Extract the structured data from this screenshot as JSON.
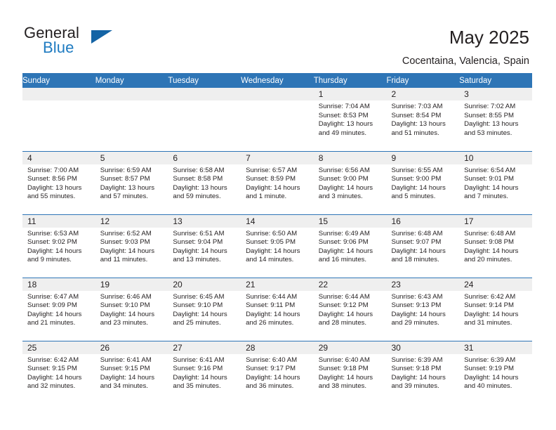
{
  "brand": {
    "line1": "General",
    "line2": "Blue",
    "accent_color": "#1f7bc1",
    "sail_color": "#1464a5"
  },
  "header": {
    "title": "May 2025",
    "location": "Cocentaina, Valencia, Spain"
  },
  "theme": {
    "header_blue": "#2e75b6",
    "daynum_band": "#efefef",
    "text": "#231f20"
  },
  "columns": [
    "Sunday",
    "Monday",
    "Tuesday",
    "Wednesday",
    "Thursday",
    "Friday",
    "Saturday"
  ],
  "labels": {
    "sunrise_prefix": "Sunrise:",
    "sunset_prefix": "Sunset:",
    "daylight_prefix": "Daylight:"
  },
  "weeks": [
    [
      {
        "day": "",
        "empty": true
      },
      {
        "day": "",
        "empty": true
      },
      {
        "day": "",
        "empty": true
      },
      {
        "day": "",
        "empty": true
      },
      {
        "day": "1",
        "sunrise": "Sunrise: 7:04 AM",
        "sunset": "Sunset: 8:53 PM",
        "daylight_l1": "Daylight: 13 hours",
        "daylight_l2": "and 49 minutes."
      },
      {
        "day": "2",
        "sunrise": "Sunrise: 7:03 AM",
        "sunset": "Sunset: 8:54 PM",
        "daylight_l1": "Daylight: 13 hours",
        "daylight_l2": "and 51 minutes."
      },
      {
        "day": "3",
        "sunrise": "Sunrise: 7:02 AM",
        "sunset": "Sunset: 8:55 PM",
        "daylight_l1": "Daylight: 13 hours",
        "daylight_l2": "and 53 minutes."
      }
    ],
    [
      {
        "day": "4",
        "sunrise": "Sunrise: 7:00 AM",
        "sunset": "Sunset: 8:56 PM",
        "daylight_l1": "Daylight: 13 hours",
        "daylight_l2": "and 55 minutes."
      },
      {
        "day": "5",
        "sunrise": "Sunrise: 6:59 AM",
        "sunset": "Sunset: 8:57 PM",
        "daylight_l1": "Daylight: 13 hours",
        "daylight_l2": "and 57 minutes."
      },
      {
        "day": "6",
        "sunrise": "Sunrise: 6:58 AM",
        "sunset": "Sunset: 8:58 PM",
        "daylight_l1": "Daylight: 13 hours",
        "daylight_l2": "and 59 minutes."
      },
      {
        "day": "7",
        "sunrise": "Sunrise: 6:57 AM",
        "sunset": "Sunset: 8:59 PM",
        "daylight_l1": "Daylight: 14 hours",
        "daylight_l2": "and 1 minute."
      },
      {
        "day": "8",
        "sunrise": "Sunrise: 6:56 AM",
        "sunset": "Sunset: 9:00 PM",
        "daylight_l1": "Daylight: 14 hours",
        "daylight_l2": "and 3 minutes."
      },
      {
        "day": "9",
        "sunrise": "Sunrise: 6:55 AM",
        "sunset": "Sunset: 9:00 PM",
        "daylight_l1": "Daylight: 14 hours",
        "daylight_l2": "and 5 minutes."
      },
      {
        "day": "10",
        "sunrise": "Sunrise: 6:54 AM",
        "sunset": "Sunset: 9:01 PM",
        "daylight_l1": "Daylight: 14 hours",
        "daylight_l2": "and 7 minutes."
      }
    ],
    [
      {
        "day": "11",
        "sunrise": "Sunrise: 6:53 AM",
        "sunset": "Sunset: 9:02 PM",
        "daylight_l1": "Daylight: 14 hours",
        "daylight_l2": "and 9 minutes."
      },
      {
        "day": "12",
        "sunrise": "Sunrise: 6:52 AM",
        "sunset": "Sunset: 9:03 PM",
        "daylight_l1": "Daylight: 14 hours",
        "daylight_l2": "and 11 minutes."
      },
      {
        "day": "13",
        "sunrise": "Sunrise: 6:51 AM",
        "sunset": "Sunset: 9:04 PM",
        "daylight_l1": "Daylight: 14 hours",
        "daylight_l2": "and 13 minutes."
      },
      {
        "day": "14",
        "sunrise": "Sunrise: 6:50 AM",
        "sunset": "Sunset: 9:05 PM",
        "daylight_l1": "Daylight: 14 hours",
        "daylight_l2": "and 14 minutes."
      },
      {
        "day": "15",
        "sunrise": "Sunrise: 6:49 AM",
        "sunset": "Sunset: 9:06 PM",
        "daylight_l1": "Daylight: 14 hours",
        "daylight_l2": "and 16 minutes."
      },
      {
        "day": "16",
        "sunrise": "Sunrise: 6:48 AM",
        "sunset": "Sunset: 9:07 PM",
        "daylight_l1": "Daylight: 14 hours",
        "daylight_l2": "and 18 minutes."
      },
      {
        "day": "17",
        "sunrise": "Sunrise: 6:48 AM",
        "sunset": "Sunset: 9:08 PM",
        "daylight_l1": "Daylight: 14 hours",
        "daylight_l2": "and 20 minutes."
      }
    ],
    [
      {
        "day": "18",
        "sunrise": "Sunrise: 6:47 AM",
        "sunset": "Sunset: 9:09 PM",
        "daylight_l1": "Daylight: 14 hours",
        "daylight_l2": "and 21 minutes."
      },
      {
        "day": "19",
        "sunrise": "Sunrise: 6:46 AM",
        "sunset": "Sunset: 9:10 PM",
        "daylight_l1": "Daylight: 14 hours",
        "daylight_l2": "and 23 minutes."
      },
      {
        "day": "20",
        "sunrise": "Sunrise: 6:45 AM",
        "sunset": "Sunset: 9:10 PM",
        "daylight_l1": "Daylight: 14 hours",
        "daylight_l2": "and 25 minutes."
      },
      {
        "day": "21",
        "sunrise": "Sunrise: 6:44 AM",
        "sunset": "Sunset: 9:11 PM",
        "daylight_l1": "Daylight: 14 hours",
        "daylight_l2": "and 26 minutes."
      },
      {
        "day": "22",
        "sunrise": "Sunrise: 6:44 AM",
        "sunset": "Sunset: 9:12 PM",
        "daylight_l1": "Daylight: 14 hours",
        "daylight_l2": "and 28 minutes."
      },
      {
        "day": "23",
        "sunrise": "Sunrise: 6:43 AM",
        "sunset": "Sunset: 9:13 PM",
        "daylight_l1": "Daylight: 14 hours",
        "daylight_l2": "and 29 minutes."
      },
      {
        "day": "24",
        "sunrise": "Sunrise: 6:42 AM",
        "sunset": "Sunset: 9:14 PM",
        "daylight_l1": "Daylight: 14 hours",
        "daylight_l2": "and 31 minutes."
      }
    ],
    [
      {
        "day": "25",
        "sunrise": "Sunrise: 6:42 AM",
        "sunset": "Sunset: 9:15 PM",
        "daylight_l1": "Daylight: 14 hours",
        "daylight_l2": "and 32 minutes."
      },
      {
        "day": "26",
        "sunrise": "Sunrise: 6:41 AM",
        "sunset": "Sunset: 9:15 PM",
        "daylight_l1": "Daylight: 14 hours",
        "daylight_l2": "and 34 minutes."
      },
      {
        "day": "27",
        "sunrise": "Sunrise: 6:41 AM",
        "sunset": "Sunset: 9:16 PM",
        "daylight_l1": "Daylight: 14 hours",
        "daylight_l2": "and 35 minutes."
      },
      {
        "day": "28",
        "sunrise": "Sunrise: 6:40 AM",
        "sunset": "Sunset: 9:17 PM",
        "daylight_l1": "Daylight: 14 hours",
        "daylight_l2": "and 36 minutes."
      },
      {
        "day": "29",
        "sunrise": "Sunrise: 6:40 AM",
        "sunset": "Sunset: 9:18 PM",
        "daylight_l1": "Daylight: 14 hours",
        "daylight_l2": "and 38 minutes."
      },
      {
        "day": "30",
        "sunrise": "Sunrise: 6:39 AM",
        "sunset": "Sunset: 9:18 PM",
        "daylight_l1": "Daylight: 14 hours",
        "daylight_l2": "and 39 minutes."
      },
      {
        "day": "31",
        "sunrise": "Sunrise: 6:39 AM",
        "sunset": "Sunset: 9:19 PM",
        "daylight_l1": "Daylight: 14 hours",
        "daylight_l2": "and 40 minutes."
      }
    ]
  ]
}
